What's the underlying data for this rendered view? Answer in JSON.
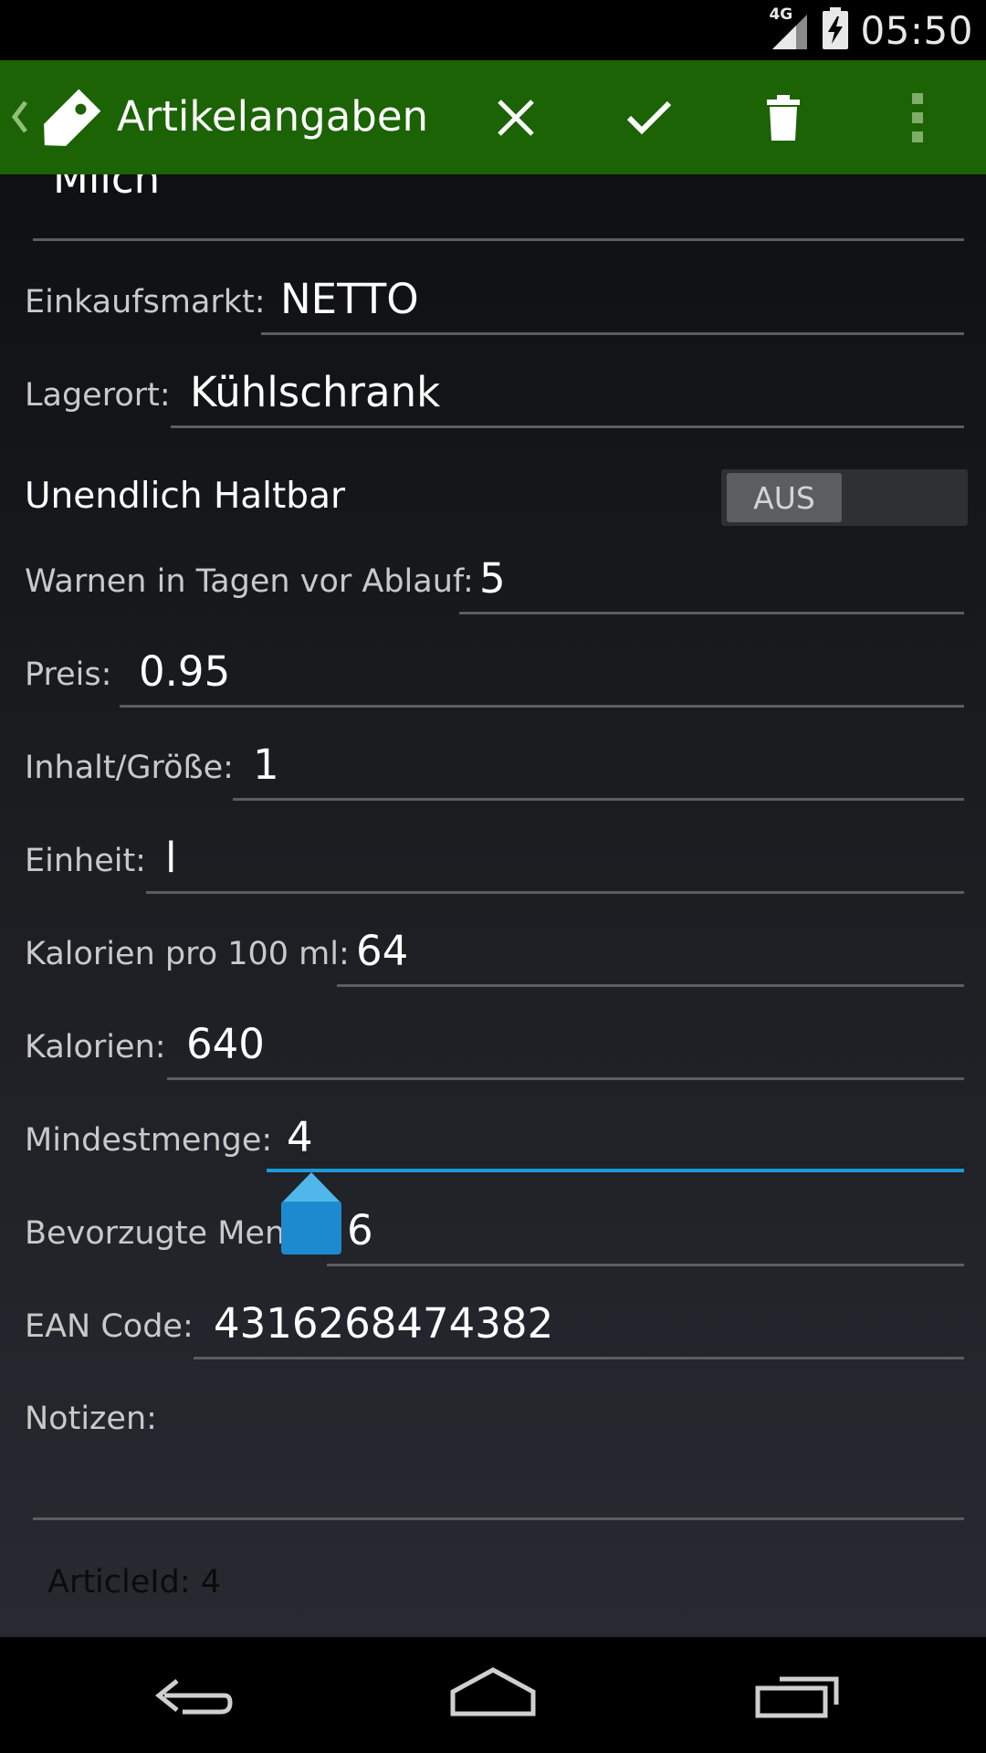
{
  "status": {
    "network": "4G",
    "time": "05:50"
  },
  "actionbar": {
    "title": "Artikelangaben"
  },
  "icons": {
    "up": "chevron-left-icon",
    "logo": "tag-icon",
    "cancel": "close-icon",
    "save": "check-icon",
    "delete": "trash-icon",
    "overflow": "more-vert-icon",
    "cursor_handle": "text-handle-icon",
    "back": "back-icon",
    "home": "home-icon",
    "recents": "recents-icon"
  },
  "colors": {
    "actionbar": "#1b6304",
    "accent": "#1a9ad6",
    "background": "#1b1d21"
  },
  "form": {
    "name_value": "Milch",
    "market_label": "Einkaufsmarkt:",
    "market_value": "NETTO",
    "storage_label": "Lagerort:",
    "storage_value": "Kühlschrank",
    "infinite_label": "Unendlich Haltbar",
    "infinite_toggle": "AUS",
    "warn_label": "Warnen in Tagen vor Ablauf:",
    "warn_value": "5",
    "price_label": "Preis:",
    "price_value": "0.95",
    "size_label": "Inhalt/Größe:",
    "size_value": "1",
    "unit_label": "Einheit:",
    "unit_value": "l",
    "kcal100_label": "Kalorien pro 100 ml:",
    "kcal100_value": "64",
    "kcal_label": "Kalorien:",
    "kcal_value": "640",
    "min_label": "Mindestmenge:",
    "min_value": "4",
    "preferred_label": "Bevorzugte Menge:",
    "preferred_value": "6",
    "ean_label": "EAN Code:",
    "ean_value": "4316268474382",
    "notes_label": "Notizen:",
    "notes_value": "",
    "article_id": "ArticleId: 4"
  }
}
